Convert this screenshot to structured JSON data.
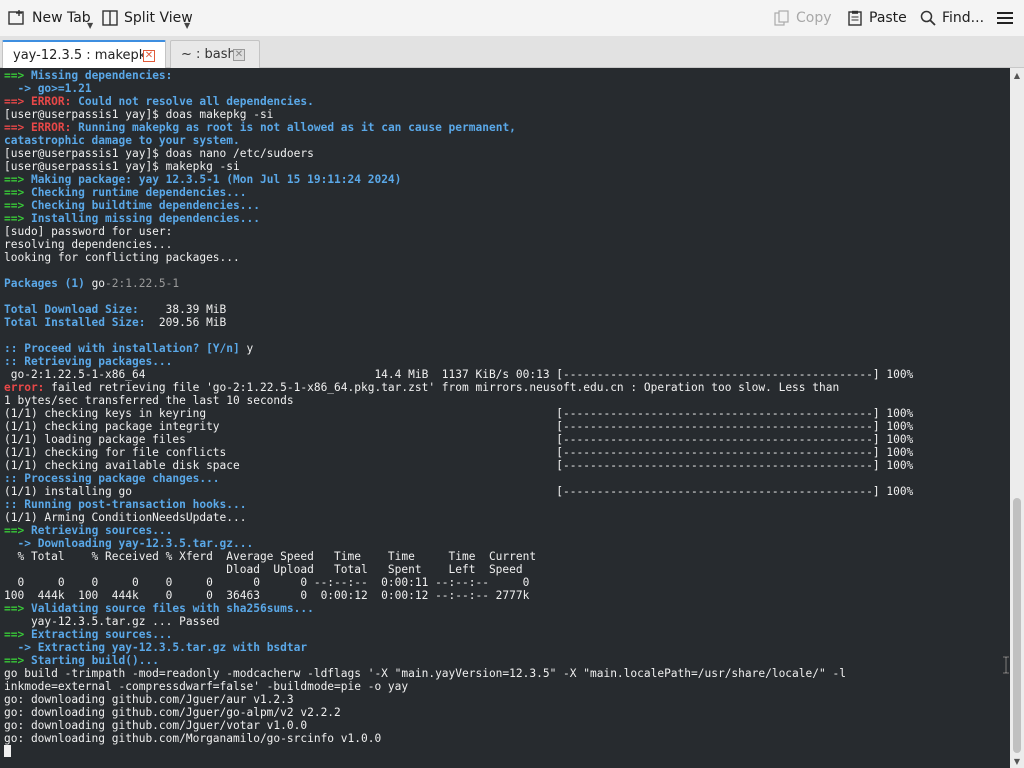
{
  "toolbar": {
    "new_tab": "New Tab",
    "split_view": "Split View",
    "copy": "Copy",
    "paste": "Paste",
    "find": "Find..."
  },
  "tabs": [
    {
      "label": "yay-12.3.5 : makepkg",
      "active": true
    },
    {
      "label": "~ : bash",
      "active": false
    }
  ],
  "colors": {
    "arrow_green": "#38c838",
    "message_blue": "#5aa8e8",
    "error_red": "#e84848",
    "terminal_bg": "#272b2f",
    "tab_accent": "#3d8ee0"
  },
  "terminal": {
    "lines": [
      [
        [
          "==> ",
          "green"
        ],
        [
          "Missing dependencies:",
          "blue"
        ]
      ],
      [
        [
          "  -> ",
          "blue"
        ],
        [
          "go>=1.21",
          "blue"
        ]
      ],
      [
        [
          "==> ",
          "red"
        ],
        [
          "ERROR: ",
          "red"
        ],
        [
          "Could not resolve all dependencies.",
          "blue"
        ]
      ],
      [
        [
          "[user@userpassis1 yay]$ doas makepkg -si",
          ""
        ]
      ],
      [
        [
          "==> ",
          "red"
        ],
        [
          "ERROR: ",
          "red"
        ],
        [
          "Running makepkg as root is not allowed as it can cause permanent,",
          "blue"
        ]
      ],
      [
        [
          "catastrophic damage to your system.",
          "blue"
        ]
      ],
      [
        [
          "[user@userpassis1 yay]$ doas nano /etc/sudoers",
          ""
        ]
      ],
      [
        [
          "[user@userpassis1 yay]$ makepkg -si",
          ""
        ]
      ],
      [
        [
          "==> ",
          "green"
        ],
        [
          "Making package: yay 12.3.5-1 (Mon Jul 15 19:11:24 2024)",
          "blue"
        ]
      ],
      [
        [
          "==> ",
          "green"
        ],
        [
          "Checking runtime dependencies...",
          "blue"
        ]
      ],
      [
        [
          "==> ",
          "green"
        ],
        [
          "Checking buildtime dependencies...",
          "blue"
        ]
      ],
      [
        [
          "==> ",
          "green"
        ],
        [
          "Installing missing dependencies...",
          "blue"
        ]
      ],
      [
        [
          "[sudo] password for user:",
          ""
        ]
      ],
      [
        [
          "resolving dependencies...",
          ""
        ]
      ],
      [
        [
          "looking for conflicting packages...",
          ""
        ]
      ],
      [
        [
          "",
          ""
        ]
      ],
      [
        [
          "Packages (1) ",
          "blue"
        ],
        [
          "go",
          ""
        ],
        [
          "-2:1.22.5-1",
          "gray"
        ]
      ],
      [
        [
          "",
          ""
        ]
      ],
      [
        [
          "Total Download Size:",
          "blue"
        ],
        [
          "    38.39 MiB",
          ""
        ]
      ],
      [
        [
          "Total Installed Size:",
          "blue"
        ],
        [
          "  209.56 MiB",
          ""
        ]
      ],
      [
        [
          "",
          ""
        ]
      ],
      [
        [
          ":: ",
          "blue"
        ],
        [
          "Proceed with installation? [Y/n] ",
          "blue"
        ],
        [
          "y",
          ""
        ]
      ],
      [
        [
          ":: ",
          "blue"
        ],
        [
          "Retrieving packages...",
          "blue"
        ]
      ],
      [
        [
          " go-2:1.22.5-1-x86_64                                  14.4 MiB  1137 KiB/s 00:13 [----------------------------------------------] 100%",
          ""
        ]
      ],
      [
        [
          "error: ",
          "red"
        ],
        [
          "failed retrieving file 'go-2:1.22.5-1-x86_64.pkg.tar.zst' from mirrors.neusoft.edu.cn : Operation too slow. Less than",
          ""
        ]
      ],
      [
        [
          "1 bytes/sec transferred the last 10 seconds",
          ""
        ]
      ],
      [
        [
          "(1/1) checking keys in keyring                                                    [----------------------------------------------] 100%",
          ""
        ]
      ],
      [
        [
          "(1/1) checking package integrity                                                  [----------------------------------------------] 100%",
          ""
        ]
      ],
      [
        [
          "(1/1) loading package files                                                       [----------------------------------------------] 100%",
          ""
        ]
      ],
      [
        [
          "(1/1) checking for file conflicts                                                 [----------------------------------------------] 100%",
          ""
        ]
      ],
      [
        [
          "(1/1) checking available disk space                                               [----------------------------------------------] 100%",
          ""
        ]
      ],
      [
        [
          ":: ",
          "blue"
        ],
        [
          "Processing package changes...",
          "blue"
        ]
      ],
      [
        [
          "(1/1) installing go                                                               [----------------------------------------------] 100%",
          ""
        ]
      ],
      [
        [
          ":: ",
          "blue"
        ],
        [
          "Running post-transaction hooks...",
          "blue"
        ]
      ],
      [
        [
          "(1/1) Arming ConditionNeedsUpdate...",
          ""
        ]
      ],
      [
        [
          "==> ",
          "green"
        ],
        [
          "Retrieving sources...",
          "blue"
        ]
      ],
      [
        [
          "  -> ",
          "blue"
        ],
        [
          "Downloading yay-12.3.5.tar.gz...",
          "blue"
        ]
      ],
      [
        [
          "  % Total    % Received % Xferd  Average Speed   Time    Time     Time  Current",
          ""
        ]
      ],
      [
        [
          "                                 Dload  Upload   Total   Spent    Left  Speed",
          ""
        ]
      ],
      [
        [
          "  0     0    0     0    0     0      0      0 --:--:--  0:00:11 --:--:--     0",
          ""
        ]
      ],
      [
        [
          "100  444k  100  444k    0     0  36463      0  0:00:12  0:00:12 --:--:-- 2777k",
          ""
        ]
      ],
      [
        [
          "==> ",
          "green"
        ],
        [
          "Validating source files with sha256sums...",
          "blue"
        ]
      ],
      [
        [
          "    yay-12.3.5.tar.gz ... Passed",
          ""
        ]
      ],
      [
        [
          "==> ",
          "green"
        ],
        [
          "Extracting sources...",
          "blue"
        ]
      ],
      [
        [
          "  -> ",
          "blue"
        ],
        [
          "Extracting yay-12.3.5.tar.gz with bsdtar",
          "blue"
        ]
      ],
      [
        [
          "==> ",
          "green"
        ],
        [
          "Starting build()...",
          "blue"
        ]
      ],
      [
        [
          "go build -trimpath -mod=readonly -modcacherw -ldflags '-X \"main.yayVersion=12.3.5\" -X \"main.localePath=/usr/share/locale/\" -l",
          ""
        ]
      ],
      [
        [
          "inkmode=external -compressdwarf=false' -buildmode=pie -o yay",
          ""
        ]
      ],
      [
        [
          "go: downloading github.com/Jguer/aur v1.2.3",
          ""
        ]
      ],
      [
        [
          "go: downloading github.com/Jguer/go-alpm/v2 v2.2.2",
          ""
        ]
      ],
      [
        [
          "go: downloading github.com/Jguer/votar v1.0.0",
          ""
        ]
      ],
      [
        [
          "go: downloading github.com/Morganamilo/go-srcinfo v1.0.0",
          ""
        ]
      ]
    ]
  }
}
